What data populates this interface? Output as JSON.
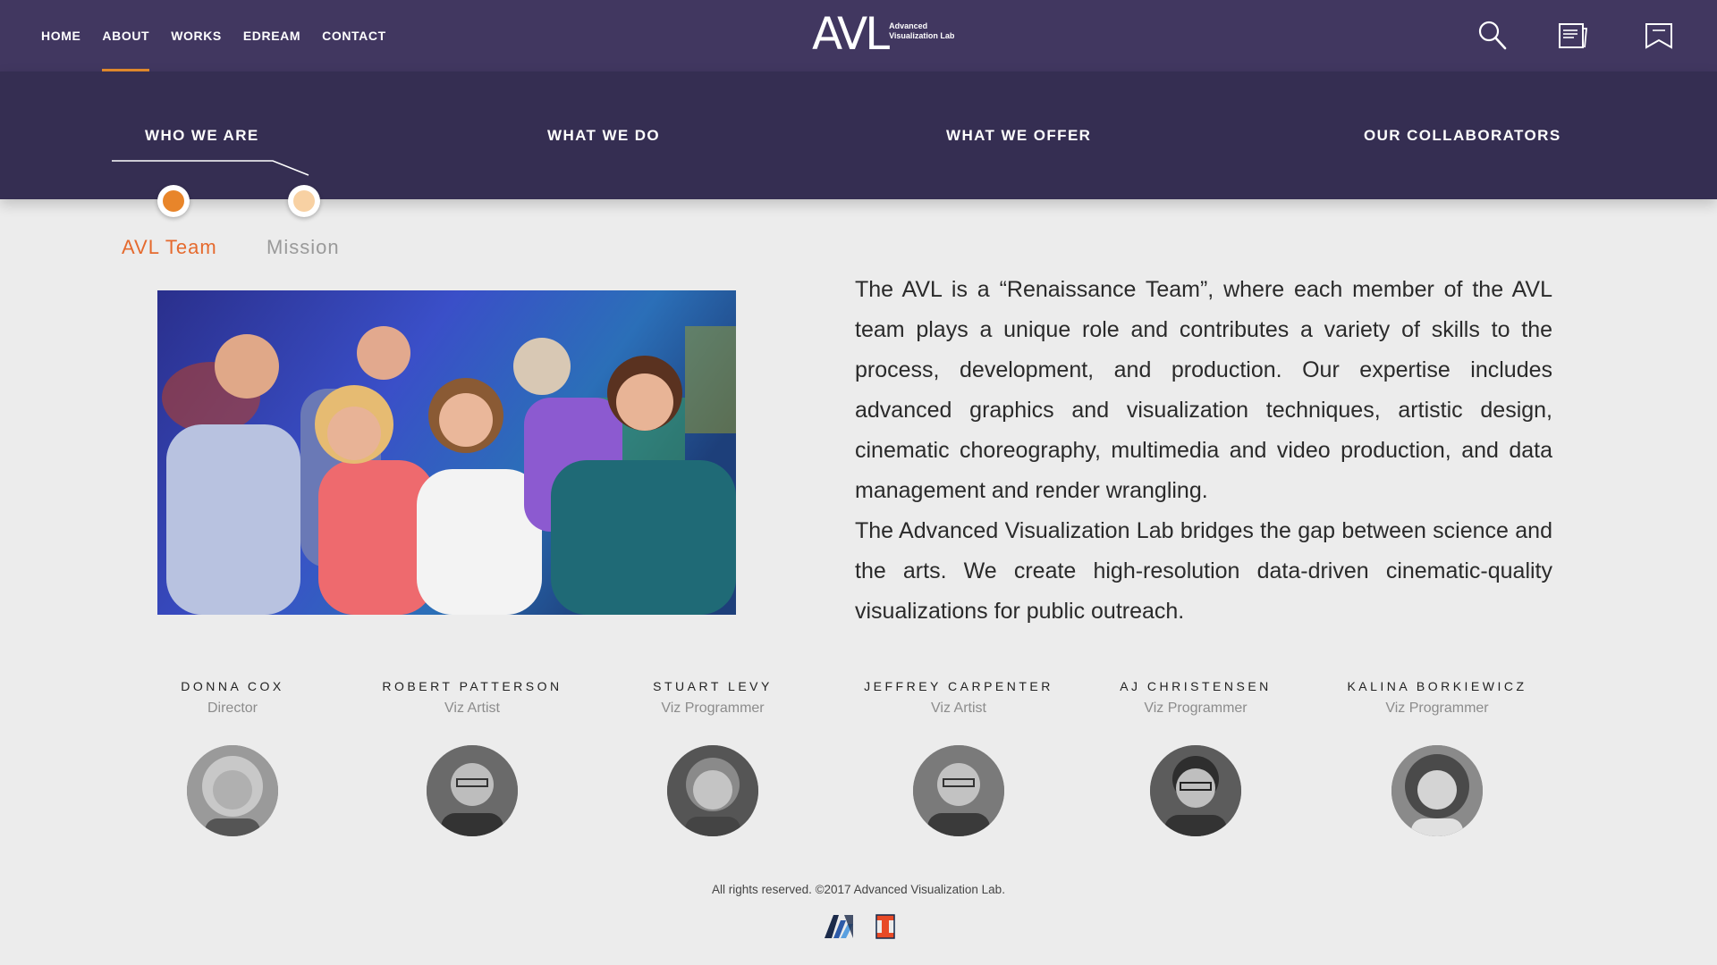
{
  "nav": {
    "items": [
      {
        "label": "HOME",
        "active": false
      },
      {
        "label": "ABOUT",
        "active": true
      },
      {
        "label": "WORKS",
        "active": false
      },
      {
        "label": "EDREAM",
        "active": false
      },
      {
        "label": "CONTACT",
        "active": false
      }
    ]
  },
  "logo": {
    "mark": "AVL",
    "line1": "Advanced",
    "line2": "Visualization Lab"
  },
  "icons": {
    "search": "search-icon",
    "news": "newspaper-icon",
    "bookmark": "bookmark-icon"
  },
  "subnav": {
    "items": [
      {
        "label": "WHO WE ARE",
        "active": true
      },
      {
        "label": "WHAT WE DO",
        "active": false
      },
      {
        "label": "WHAT WE OFFER",
        "active": false
      },
      {
        "label": "OUR COLLABORATORS",
        "active": false
      }
    ],
    "sections": [
      {
        "label": "AVL Team",
        "active": true,
        "color": "#e8852a"
      },
      {
        "label": "Mission",
        "active": false,
        "color": "#f8d1a3"
      }
    ]
  },
  "intro": {
    "paragraph1": "The AVL is a “Renaissance Team”, where each member of the AVL team plays a unique role and contributes a variety of skills to the process, development, and production.  Our expertise includes advanced graphics and visualization techniques, artistic design, cinematic choreography, multimedia and video production, and data management and render wrangling.",
    "paragraph2": "The Advanced Visualization Lab bridges the gap between science and the arts. We create high-resolution data-driven cinematic-quality visualizations for public outreach."
  },
  "team": [
    {
      "name": "DONNA COX",
      "role": "Director"
    },
    {
      "name": "ROBERT PATTERSON",
      "role": "Viz Artist"
    },
    {
      "name": "STUART LEVY",
      "role": "Viz Programmer"
    },
    {
      "name": "JEFFREY CARPENTER",
      "role": "Viz Artist"
    },
    {
      "name": "AJ CHRISTENSEN",
      "role": "Viz Programmer"
    },
    {
      "name": "KALINA BORKIEWICZ",
      "role": "Viz Programmer"
    }
  ],
  "footer": {
    "copyright": "All rights reserved. ©2017 Advanced Visualization Lab."
  },
  "colors": {
    "topbar": "#413760",
    "subnav": "#352e52",
    "accent": "#e8852a",
    "background": "#ececec"
  }
}
